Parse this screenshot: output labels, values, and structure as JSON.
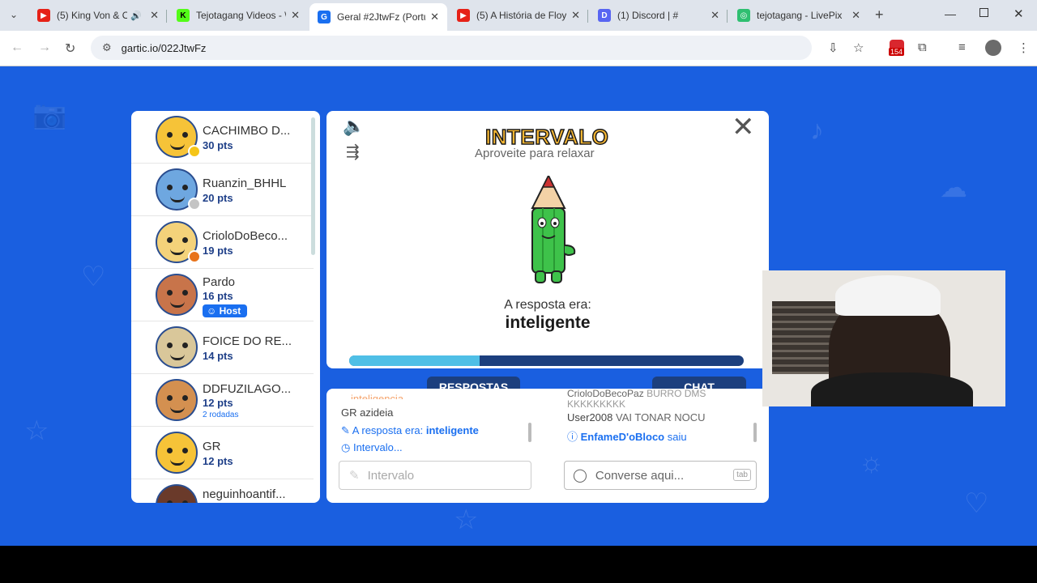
{
  "browser": {
    "tabs": [
      {
        "title": "(5) King Von & Ol",
        "fav_color": "#e62117",
        "fav_glyph": "▶",
        "muted": true
      },
      {
        "title": "Tejotagang Videos - \\",
        "fav_color": "#53fc18",
        "fav_glyph": "K"
      },
      {
        "title": "Geral #2JtwFz (Portug",
        "fav_color": "#1a6ff0",
        "fav_glyph": "G"
      },
      {
        "title": "(5) A História de Floy",
        "fav_color": "#e62117",
        "fav_glyph": "▶"
      },
      {
        "title": "(1) Discord | #",
        "fav_color": "#5865f2",
        "fav_glyph": "D"
      },
      {
        "title": "tejotagang - LivePix",
        "fav_color": "#2fbf71",
        "fav_glyph": "◎"
      }
    ],
    "url": "gartic.io/022JtwFz",
    "ext_badge": "154"
  },
  "players": [
    {
      "name": "CACHIMBO D...",
      "pts": "30 pts",
      "dot": "#f5c518",
      "bg": "#f6c338"
    },
    {
      "name": "Ruanzin_BHHL",
      "pts": "20 pts",
      "dot": "#c4c4c4",
      "bg": "#6ea7e0"
    },
    {
      "name": "CrioloDoBeco...",
      "pts": "19 pts",
      "dot": "#e8731a",
      "bg": "#f4d27a"
    },
    {
      "name": "Pardo",
      "pts": "16 pts",
      "host": "Host",
      "bg": "#c8744a"
    },
    {
      "name": "FOICE DO RE...",
      "pts": "14 pts",
      "bg": "#d9c79a"
    },
    {
      "name": "DDFUZILAGO...",
      "pts": "12 pts",
      "rounds": "2 rodadas",
      "bg": "#d49050"
    },
    {
      "name": "GR",
      "pts": "12 pts",
      "bg": "#f6c338"
    },
    {
      "name": "neguinhoantif...",
      "pts": "",
      "bg": "#6a3a2a"
    }
  ],
  "round": {
    "title": "INTERVALO",
    "subtitle": "Aproveite para relaxar",
    "answer_label": "A resposta era:",
    "answer": "inteligente",
    "progress": 0.33
  },
  "tabs": {
    "answers": "RESPOSTAS",
    "chat": "CHAT"
  },
  "answers_log": {
    "cut_line": "inteligencia",
    "line1_name": "GR",
    "line1_text": "azideia",
    "line2_prefix": "A resposta era:",
    "line2_value": "inteligente",
    "line3": "Intervalo..."
  },
  "answers_input": {
    "placeholder": "Intervalo"
  },
  "chat_log": {
    "line1_name": "CrioloDoBecoPaz",
    "line1_text": "BURRO DMS",
    "line1b": "KKKKKKKKK",
    "line2_name": "User2008",
    "line2_text": "VAI TONAR NOCU",
    "line3_name": "EnfameD'oBloco",
    "line3_text": "saiu"
  },
  "chat_input": {
    "placeholder": "Converse aqui...",
    "key": "tab"
  }
}
